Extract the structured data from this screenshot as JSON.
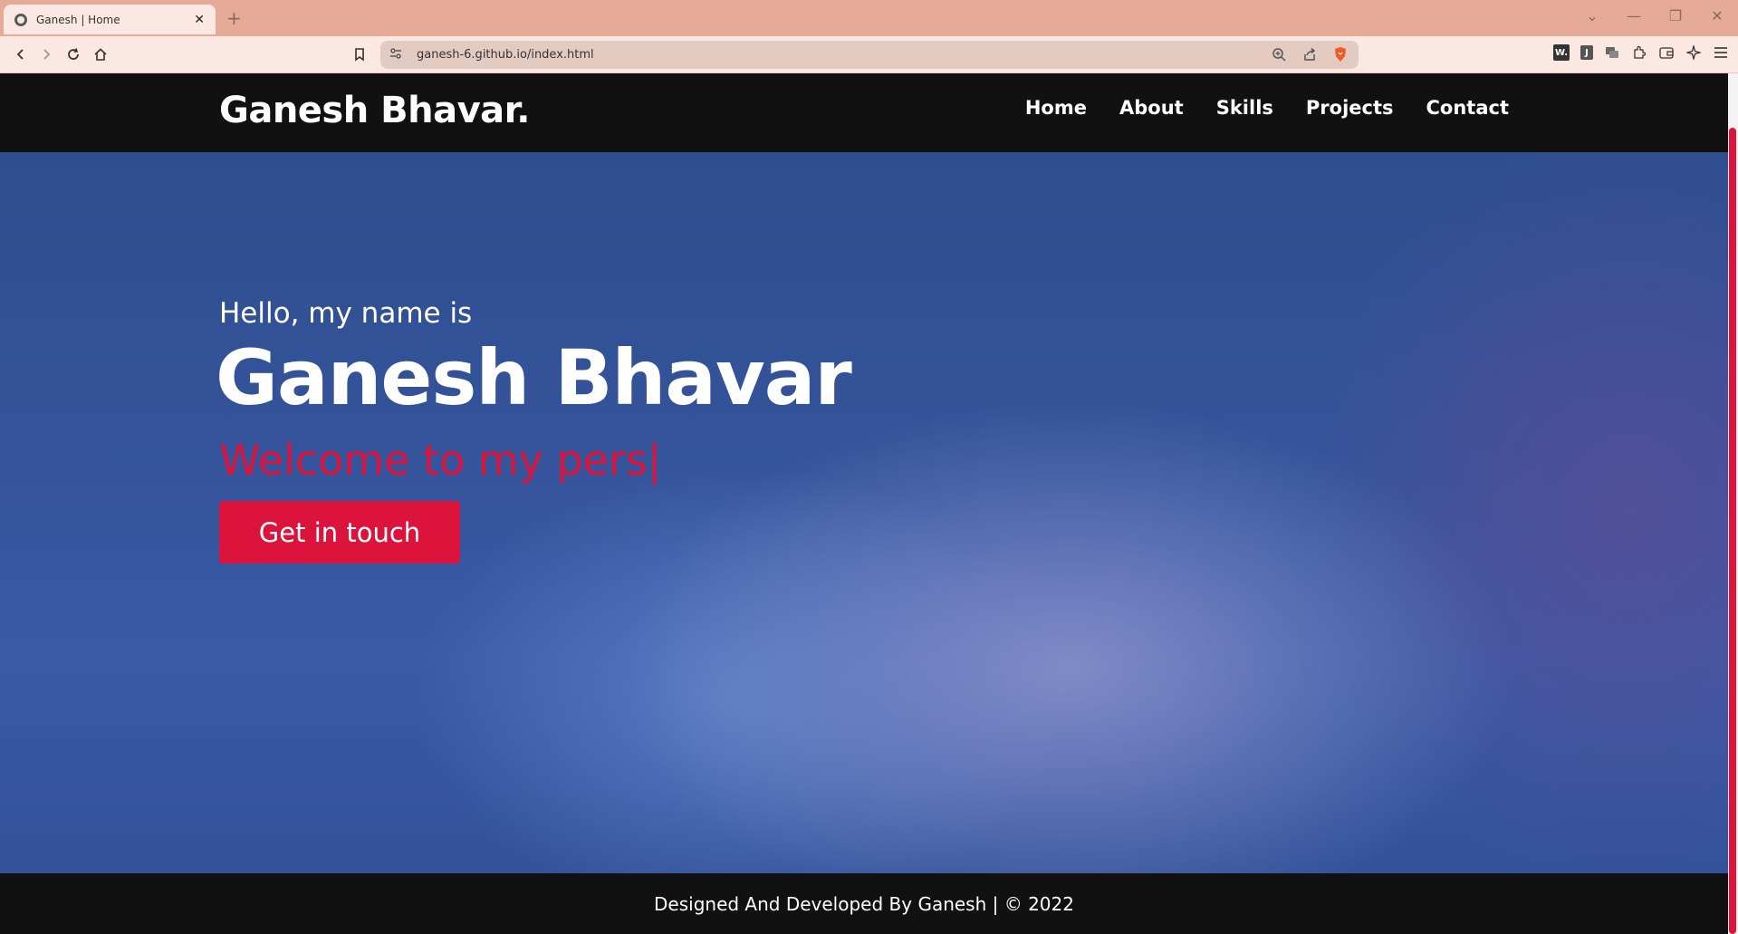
{
  "browser": {
    "tab_title": "Ganesh | Home",
    "url": "ganesh-6.github.io/index.html",
    "extensions": {
      "w_label": "W.",
      "j_label": "J"
    }
  },
  "site": {
    "logo": "Ganesh Bhavar.",
    "menu": [
      "Home",
      "About",
      "Skills",
      "Projects",
      "Contact"
    ],
    "hero": {
      "greeting": "Hello, my name is",
      "name": "Ganesh Bhavar",
      "typed_text": "Welcome to my pers",
      "cursor": "|",
      "cta_label": "Get in touch"
    },
    "footer": "Designed And Developed By Ganesh | © 2022"
  },
  "colors": {
    "accent": "#dc143c",
    "nav_bg": "#111111",
    "browser_chrome": "#e6ab98"
  },
  "icons": [
    "globe-icon",
    "close-icon",
    "plus-icon",
    "back-icon",
    "forward-icon",
    "reload-icon",
    "home-icon",
    "bookmark-icon",
    "site-settings-icon",
    "zoom-icon",
    "share-icon",
    "brave-shield-icon",
    "extensions-icon",
    "wallet-icon",
    "leo-icon",
    "menu-icon"
  ]
}
